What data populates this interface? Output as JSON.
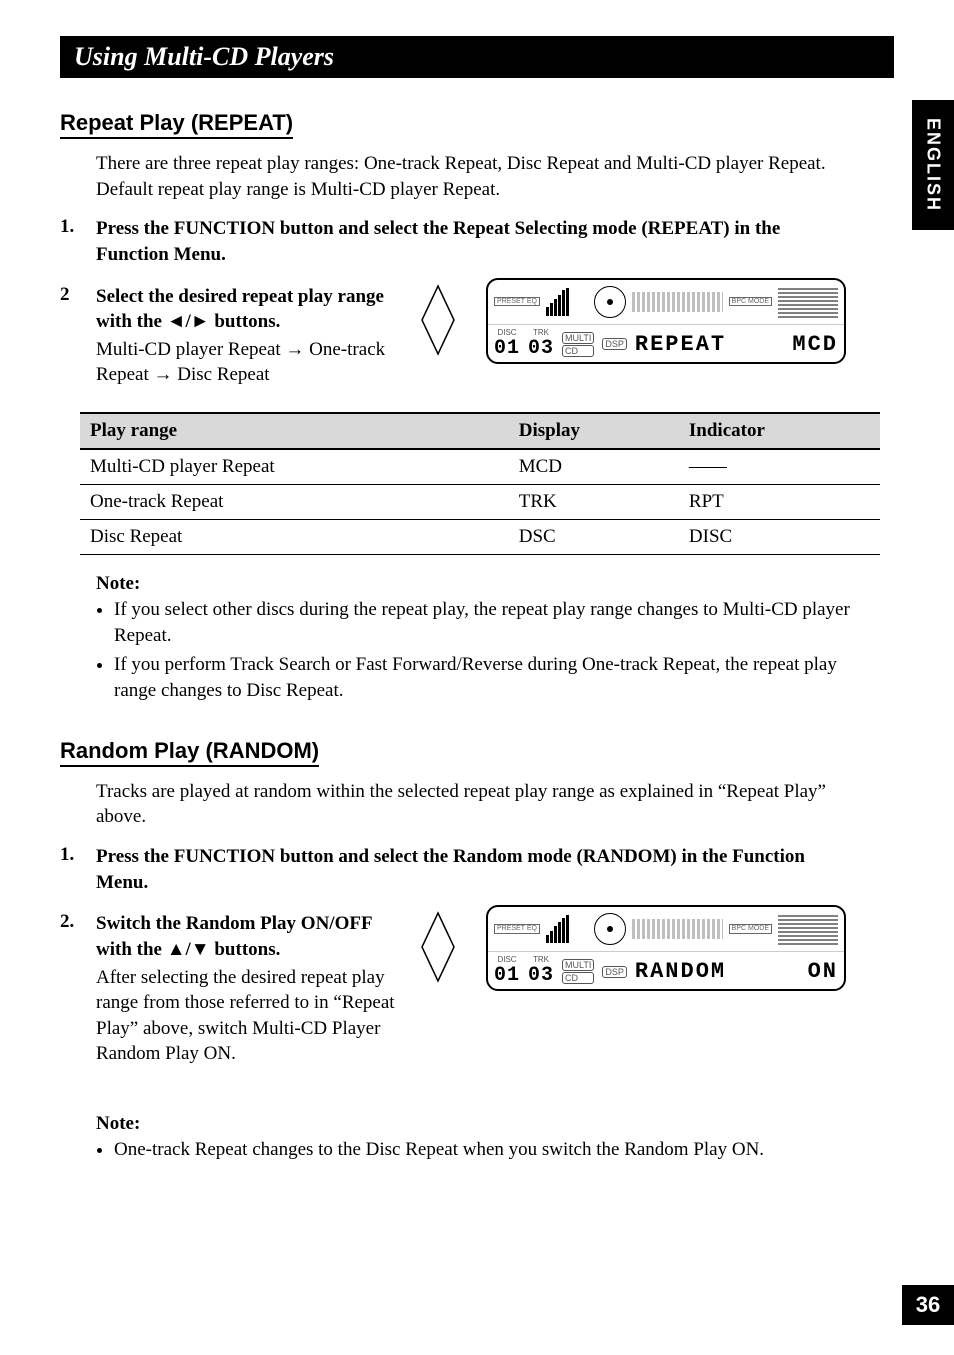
{
  "title_bar": "Using Multi-CD Players",
  "side_tab": "ENGLISH",
  "page_number": "36",
  "repeat": {
    "heading": "Repeat Play (REPEAT)",
    "intro": "There are three repeat play ranges: One-track Repeat, Disc Repeat and Multi-CD player Repeat. Default repeat play range is Multi-CD player Repeat.",
    "steps": [
      {
        "num": "1.",
        "text": "Press the FUNCTION button and select the Repeat Selecting mode (REPEAT) in the Function Menu."
      },
      {
        "num": "2",
        "text_bold": "Select the desired repeat play range with the ◄/► buttons.",
        "text_sub": "Multi-CD player Repeat → One-track Repeat → Disc Repeat"
      }
    ],
    "lcd": {
      "preset_label": "PRESET EQ",
      "bpc_label": "BPC MODE",
      "disc_label": "DISC",
      "trk_label": "TRK",
      "multi_label": "MULTI",
      "cd_label": "CD",
      "dsp_label": "DSP",
      "disc_num": "01",
      "trk_num": "03",
      "main_text": "REPEAT",
      "right_text": "MCD"
    },
    "table": {
      "headers": [
        "Play range",
        "Display",
        "Indicator"
      ],
      "rows": [
        [
          "Multi-CD player Repeat",
          "MCD",
          "——"
        ],
        [
          "One-track Repeat",
          "TRK",
          "RPT"
        ],
        [
          "Disc Repeat",
          "DSC",
          "DISC"
        ]
      ]
    },
    "note_title": "Note:",
    "notes": [
      "If you select other discs during the repeat play, the repeat play range changes to Multi-CD player Repeat.",
      "If you perform Track Search or Fast Forward/Reverse during One-track Repeat, the repeat play range changes to Disc Repeat."
    ]
  },
  "random": {
    "heading": "Random Play (RANDOM)",
    "intro": "Tracks are played at random within the selected repeat play range as explained in “Repeat Play” above.",
    "steps": [
      {
        "num": "1.",
        "text": "Press the FUNCTION button and select the Random mode (RANDOM) in the Function Menu."
      },
      {
        "num": "2.",
        "text_bold": "Switch the Random Play ON/OFF with the ▲/▼ buttons.",
        "text_sub": "After selecting the desired repeat play range from those referred to in “Repeat Play” above, switch Multi-CD Player Random Play ON."
      }
    ],
    "lcd": {
      "preset_label": "PRESET EQ",
      "bpc_label": "BPC MODE",
      "disc_label": "DISC",
      "trk_label": "TRK",
      "multi_label": "MULTI",
      "cd_label": "CD",
      "dsp_label": "DSP",
      "disc_num": "01",
      "trk_num": "03",
      "main_text": "RANDOM",
      "right_text": "ON"
    },
    "note_title": "Note:",
    "notes": [
      "One-track Repeat changes to the Disc Repeat when you switch the Random Play ON."
    ]
  }
}
